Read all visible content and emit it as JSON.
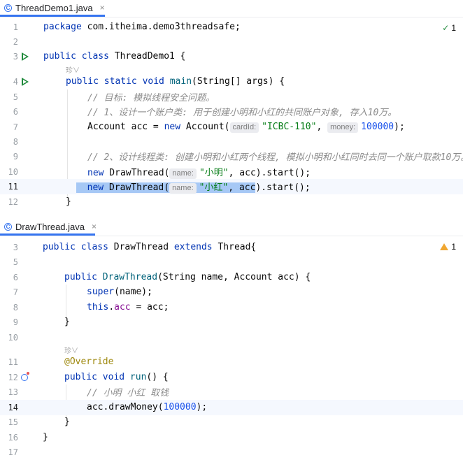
{
  "editor1": {
    "tab": {
      "label": "ThreadDemo1.java",
      "icon": "class-icon",
      "close": "×"
    },
    "status_count": "1",
    "ai_hint": "珍∨",
    "lines": [
      {
        "num": "1"
      },
      {
        "num": "2"
      },
      {
        "num": "3"
      },
      {
        "num": "4"
      },
      {
        "num": "5"
      },
      {
        "num": "6"
      },
      {
        "num": "7"
      },
      {
        "num": "8"
      },
      {
        "num": "9"
      },
      {
        "num": "10"
      },
      {
        "num": "11"
      },
      {
        "num": "12"
      }
    ],
    "code": {
      "l1_kw": "package",
      "l1_rest": " com.itheima.demo3threadsafe;",
      "l3_kw": "public class",
      "l3_rest": " ThreadDemo1 {",
      "l4_kw": "public static void",
      "l4_fn": " main",
      "l4_rest": "(String[] args) {",
      "l5_cm": "// 目标: 模拟线程安全问题。",
      "l6_cm": "// 1、设计一个账户类: 用于创建小明和小红的共同账户对象, 存入10万。",
      "l7_a": "Account acc = ",
      "l7_kw": "new",
      "l7_b": " Account(",
      "l7_hint1": "cardId:",
      "l7_str": "\"ICBC-110\"",
      "l7_c": ", ",
      "l7_hint2": "money:",
      "l7_num": "100000",
      "l7_d": ");",
      "l9_cm": "// 2、设计线程类: 创建小明和小红两个线程, 模拟小明和小红同时去同一个账户取款10万。",
      "l10_kw": "new",
      "l10_a": " DrawThread(",
      "l10_hint": "name:",
      "l10_str": "\"小明\"",
      "l10_b": ", acc).start();",
      "l11_kw": "new",
      "l11_a": " DrawThread(",
      "l11_hint": "name:",
      "l11_str": "\"小红\"",
      "l11_b": ", acc",
      "l11_c": ").start();",
      "l12": "}"
    }
  },
  "editor2": {
    "tab": {
      "label": "DrawThread.java",
      "icon": "class-icon",
      "close": "×"
    },
    "status_count": "1",
    "ai_hint": "珍∨",
    "lines": [
      {
        "num": "3"
      },
      {
        "num": "5"
      },
      {
        "num": "6"
      },
      {
        "num": "7"
      },
      {
        "num": "8"
      },
      {
        "num": "9"
      },
      {
        "num": "10"
      },
      {
        "num": "11"
      },
      {
        "num": "12"
      },
      {
        "num": "13"
      },
      {
        "num": "14"
      },
      {
        "num": "15"
      },
      {
        "num": "16"
      },
      {
        "num": "17"
      }
    ],
    "code": {
      "l3_kw": "public class",
      "l3_a": " DrawThread ",
      "l3_kw2": "extends",
      "l3_b": " Thread{",
      "l6_kw": "public",
      "l6_fn": " DrawThread",
      "l6_a": "(String name, Account acc) {",
      "l7_kw": "super",
      "l7_a": "(name);",
      "l8_kw": "this",
      "l8_dot": ".",
      "l8_field": "acc",
      "l8_a": " = acc;",
      "l9": "}",
      "l11_ann": "@Override",
      "l12_kw": "public void",
      "l12_fn": " run",
      "l12_a": "() {",
      "l13_cm": "// 小明 小红 取钱",
      "l14_a": "acc.drawMoney(",
      "l14_num": "100000",
      "l14_b": ");",
      "l15": "}",
      "l16": "}"
    }
  },
  "colors": {
    "accent": "#3574f0",
    "run": "#208a3c",
    "keyword": "#0033b3",
    "string": "#067d17",
    "comment": "#8c8c8c",
    "selection": "#a6c8f5",
    "current_line": "#f5f8fe"
  }
}
